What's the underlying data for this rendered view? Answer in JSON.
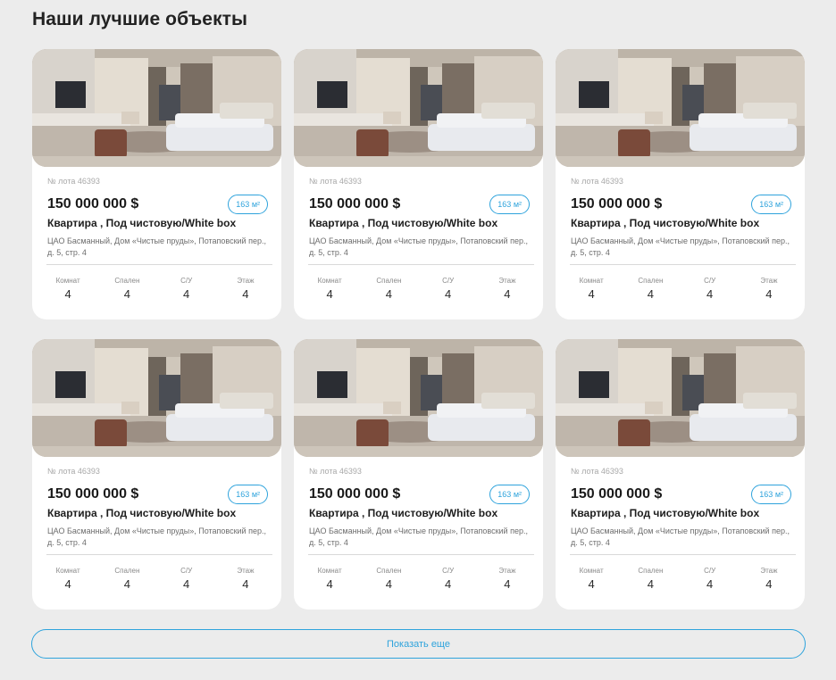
{
  "section": {
    "title": "Наши лучшие объекты"
  },
  "cards": [
    {
      "lot": "№ лота 46393",
      "price": "150 000 000 $",
      "area": "163 м²",
      "type": "Квартира , Под чистовую/White box",
      "address": "ЦАО Басманный, Дом «Чистые пруды», Потаповский пер., д. 5, стр. 4",
      "specs": [
        {
          "label": "Комнат",
          "value": "4"
        },
        {
          "label": "Спален",
          "value": "4"
        },
        {
          "label": "С/У",
          "value": "4"
        },
        {
          "label": "Этаж",
          "value": "4"
        }
      ]
    },
    {
      "lot": "№ лота 46393",
      "price": "150 000 000 $",
      "area": "163 м²",
      "type": "Квартира , Под чистовую/White box",
      "address": "ЦАО Басманный, Дом «Чистые пруды», Потаповский пер., д. 5, стр. 4",
      "specs": [
        {
          "label": "Комнат",
          "value": "4"
        },
        {
          "label": "Спален",
          "value": "4"
        },
        {
          "label": "С/У",
          "value": "4"
        },
        {
          "label": "Этаж",
          "value": "4"
        }
      ]
    },
    {
      "lot": "№ лота 46393",
      "price": "150 000 000 $",
      "area": "163 м²",
      "type": "Квартира , Под чистовую/White box",
      "address": "ЦАО Басманный, Дом «Чистые пруды», Потаповский пер., д. 5, стр. 4",
      "specs": [
        {
          "label": "Комнат",
          "value": "4"
        },
        {
          "label": "Спален",
          "value": "4"
        },
        {
          "label": "С/У",
          "value": "4"
        },
        {
          "label": "Этаж",
          "value": "4"
        }
      ]
    },
    {
      "lot": "№ лота 46393",
      "price": "150 000 000 $",
      "area": "163 м²",
      "type": "Квартира , Под чистовую/White box",
      "address": "ЦАО Басманный, Дом «Чистые пруды», Потаповский пер., д. 5, стр. 4",
      "specs": [
        {
          "label": "Комнат",
          "value": "4"
        },
        {
          "label": "Спален",
          "value": "4"
        },
        {
          "label": "С/У",
          "value": "4"
        },
        {
          "label": "Этаж",
          "value": "4"
        }
      ]
    },
    {
      "lot": "№ лота 46393",
      "price": "150 000 000 $",
      "area": "163 м²",
      "type": "Квартира , Под чистовую/White box",
      "address": "ЦАО Басманный, Дом «Чистые пруды», Потаповский пер., д. 5, стр. 4",
      "specs": [
        {
          "label": "Комнат",
          "value": "4"
        },
        {
          "label": "Спален",
          "value": "4"
        },
        {
          "label": "С/У",
          "value": "4"
        },
        {
          "label": "Этаж",
          "value": "4"
        }
      ]
    },
    {
      "lot": "№ лота 46393",
      "price": "150 000 000 $",
      "area": "163 м²",
      "type": "Квартира , Под чистовую/White box",
      "address": "ЦАО Басманный, Дом «Чистые пруды», Потаповский пер., д. 5, стр. 4",
      "specs": [
        {
          "label": "Комнат",
          "value": "4"
        },
        {
          "label": "Спален",
          "value": "4"
        },
        {
          "label": "С/У",
          "value": "4"
        },
        {
          "label": "Этаж",
          "value": "4"
        }
      ]
    }
  ],
  "more_button": {
    "label": "Показать еще"
  },
  "colors": {
    "accent": "#2ea3dc",
    "background": "#ececec",
    "card": "#ffffff"
  }
}
